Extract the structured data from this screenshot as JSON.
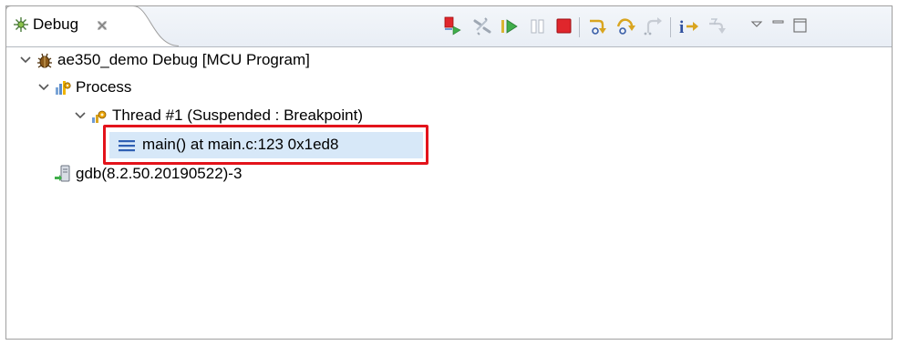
{
  "view": {
    "tab_title": "Debug",
    "tab_close_glyph": "✕",
    "icons": {
      "tab": "debug-view-icon",
      "close": "close-icon"
    }
  },
  "toolbar": {
    "buttons": [
      {
        "name": "remove-terminated-icon",
        "tooltip": "Remove All Terminated"
      },
      {
        "name": "disconnect-icon",
        "tooltip": "Disconnect"
      },
      {
        "name": "resume-icon",
        "tooltip": "Resume"
      },
      {
        "name": "suspend-icon",
        "tooltip": "Suspend"
      },
      {
        "name": "terminate-icon",
        "tooltip": "Terminate"
      },
      {
        "name": "step-into-icon",
        "tooltip": "Step Into"
      },
      {
        "name": "step-over-icon",
        "tooltip": "Step Over"
      },
      {
        "name": "step-return-icon",
        "tooltip": "Step Return"
      },
      {
        "name": "instruction-stepping-icon",
        "tooltip": "Instruction Stepping Mode"
      },
      {
        "name": "use-step-filters-icon",
        "tooltip": "Use Step Filters"
      }
    ],
    "view_menu": "view-menu-icon",
    "minimize": "minimize-icon",
    "maximize": "maximize-icon"
  },
  "tree": {
    "launch": {
      "label": "ae350_demo Debug [MCU Program]",
      "icon": "launch-bug-icon",
      "expanded": true
    },
    "process": {
      "label": "Process",
      "icon": "process-icon",
      "expanded": true
    },
    "thread": {
      "label": "Thread #1 (Suspended : Breakpoint)",
      "icon": "thread-suspended-icon",
      "expanded": true
    },
    "frame": {
      "label": "main() at main.c:123 0x1ed8",
      "icon": "stack-frame-icon",
      "selected": true
    },
    "gdb": {
      "label": "gdb(8.2.50.20190522)-3",
      "icon": "gdb-process-icon"
    }
  },
  "colors": {
    "selection": "#d7e8f8",
    "highlight_box": "#e3131b",
    "terminate_red": "#e0262c",
    "resume_green": "#3fae4a"
  }
}
